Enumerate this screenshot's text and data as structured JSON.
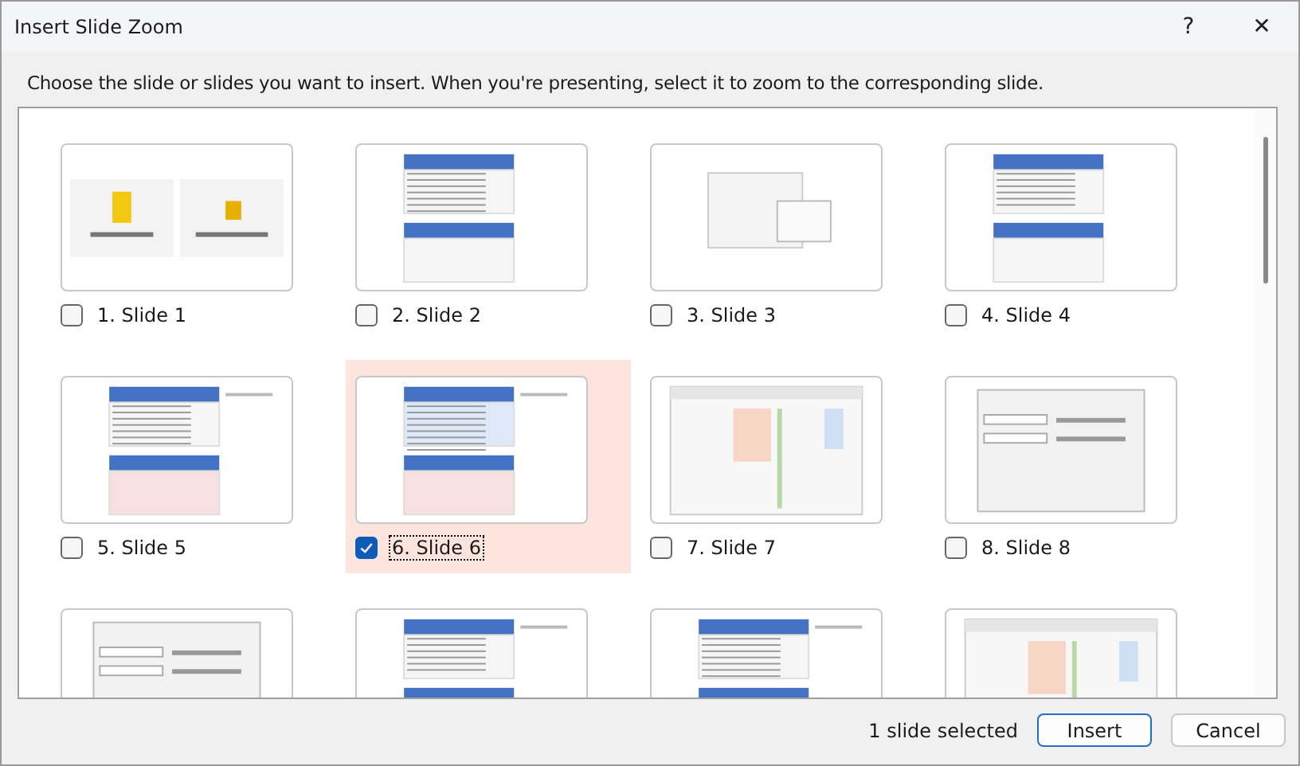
{
  "window": {
    "title": "Insert Slide Zoom",
    "help": "?",
    "close": "✕"
  },
  "instruction": "Choose the slide or slides you want to insert. When you're presenting, select it to zoom to the corresponding slide.",
  "slides": [
    {
      "label": "1. Slide 1",
      "checked": false,
      "selected": false
    },
    {
      "label": "2. Slide 2",
      "checked": false,
      "selected": false
    },
    {
      "label": "3. Slide 3",
      "checked": false,
      "selected": false
    },
    {
      "label": "4. Slide 4",
      "checked": false,
      "selected": false
    },
    {
      "label": "5. Slide 5",
      "checked": false,
      "selected": false
    },
    {
      "label": "6. Slide 6",
      "checked": true,
      "selected": true
    },
    {
      "label": "7. Slide 7",
      "checked": false,
      "selected": false
    },
    {
      "label": "8. Slide 8",
      "checked": false,
      "selected": false
    },
    {
      "kind": "picture"
    },
    {
      "kind": "picture"
    },
    {
      "kind": "picture"
    },
    {
      "kind": "picture"
    }
  ],
  "status": "1 slide selected",
  "buttons": [
    {
      "label": "Insert",
      "default": true
    },
    {
      "label": "Cancel",
      "default": false
    }
  ]
}
